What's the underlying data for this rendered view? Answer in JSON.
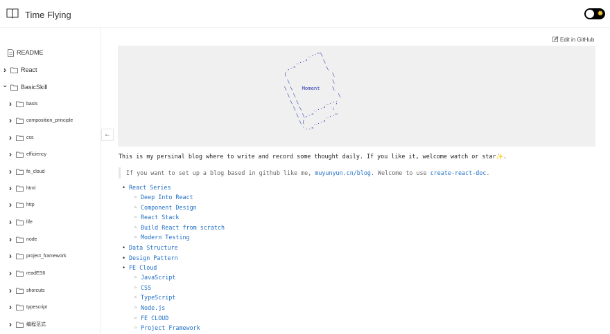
{
  "header": {
    "title": "Time Flying",
    "brand_icon": "book-open-icon",
    "theme_toggle_icon": "sun-icon"
  },
  "toolbar": {
    "edit_label": "Edit in GitHub",
    "edit_icon": "edit-icon",
    "collapse_icon": "arrow-left-icon"
  },
  "sidebar": {
    "items": [
      {
        "label": "README",
        "icon": "document-icon",
        "chevron": "",
        "level": 0
      },
      {
        "label": "React",
        "icon": "folder-icon",
        "chevron": "right",
        "level": 0
      },
      {
        "label": "BasicSkill",
        "icon": "folder-icon",
        "chevron": "down",
        "level": 0
      },
      {
        "label": "basis",
        "icon": "folder-icon",
        "chevron": "right",
        "level": 1
      },
      {
        "label": "composition_principle",
        "icon": "folder-icon",
        "chevron": "right",
        "level": 1
      },
      {
        "label": "css",
        "icon": "folder-icon",
        "chevron": "right",
        "level": 1
      },
      {
        "label": "efficiency",
        "icon": "folder-icon",
        "chevron": "right",
        "level": 1
      },
      {
        "label": "fe_cloud",
        "icon": "folder-icon",
        "chevron": "right",
        "level": 1
      },
      {
        "label": "html",
        "icon": "folder-icon",
        "chevron": "right",
        "level": 1
      },
      {
        "label": "http",
        "icon": "folder-icon",
        "chevron": "right",
        "level": 1
      },
      {
        "label": "life",
        "icon": "folder-icon",
        "chevron": "right",
        "level": 1
      },
      {
        "label": "node",
        "icon": "folder-icon",
        "chevron": "right",
        "level": 1
      },
      {
        "label": "project_framework",
        "icon": "folder-icon",
        "chevron": "right",
        "level": 1
      },
      {
        "label": "readES6",
        "icon": "folder-icon",
        "chevron": "right",
        "level": 1
      },
      {
        "label": "shorcuts",
        "icon": "folder-icon",
        "chevron": "right",
        "level": 1
      },
      {
        "label": "typescript",
        "icon": "folder-icon",
        "chevron": "right",
        "level": 1
      },
      {
        "label": "编程范式",
        "icon": "folder-icon",
        "chevron": "right",
        "level": 1
      }
    ]
  },
  "main": {
    "ascii_art": [
      "             _.-\"\\",
      "         _.-\"     \\",
      "      ,-\"          \\",
      "     (               \\",
      "      \\              \\",
      "     \\ \\   Moment    \\",
      "      \\ \\              \\",
      "       \\ \\         _.-;",
      "        \\ \\    _.-\"  :",
      "         \\ \\,-\"    _.-\"",
      "          \\(   _.-\"",
      "           `--\""
    ],
    "intro_text": "This is my persinal blog where to write and record some thought daily. If you like it, welcome watch or star",
    "intro_star": "✨",
    "intro_end": ".",
    "quote_prefix": "If you want to set up a blog based in github like me, ",
    "quote_link1": "muyunyun.cn/blog",
    "quote_middle": ". Welcome to use ",
    "quote_link2": "create-react-doc",
    "quote_end": ".",
    "list": [
      {
        "label": "React Series",
        "level": 0
      },
      {
        "label": "Deep Into React",
        "level": 1
      },
      {
        "label": "Component Design",
        "level": 1
      },
      {
        "label": "React Stack",
        "level": 1
      },
      {
        "label": "Build React from scratch",
        "level": 1
      },
      {
        "label": "Modern Testing",
        "level": 1
      },
      {
        "label": "Data Structure",
        "level": 0
      },
      {
        "label": "Design Pattern",
        "level": 0
      },
      {
        "label": "FE Cloud",
        "level": 0
      },
      {
        "label": "JavaScript",
        "level": 1
      },
      {
        "label": "CSS",
        "level": 1
      },
      {
        "label": "TypeScript",
        "level": 1
      },
      {
        "label": "Node.js",
        "level": 1
      },
      {
        "label": "FE CLOUD",
        "level": 1
      },
      {
        "label": "Project Framework",
        "level": 1
      }
    ],
    "bullet_markers": {
      "level0": "•",
      "level1": "◦"
    }
  },
  "colors": {
    "link": "#1f6fc5",
    "code_bg": "#f0f0f0",
    "ascii": "#2f3fae",
    "star": "#f2b01e"
  }
}
